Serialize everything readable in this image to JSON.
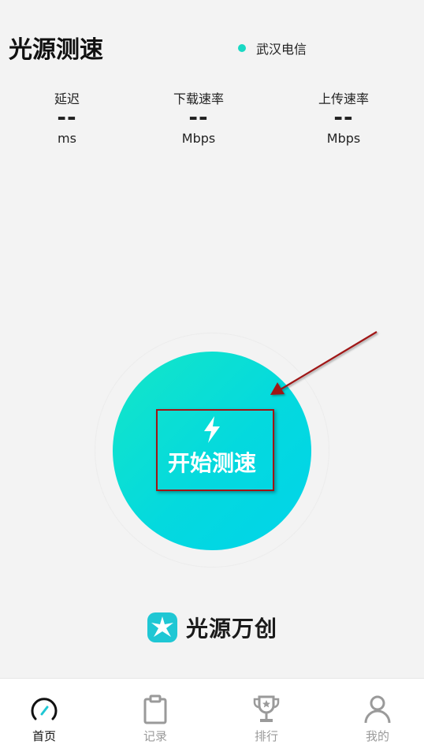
{
  "header": {
    "title": "光源测速",
    "network_name": "武汉电信",
    "network_dot_color": "#19d9c4"
  },
  "metrics": [
    {
      "label": "延迟",
      "value": "--",
      "unit": "ms"
    },
    {
      "label": "下载速率",
      "value": "--",
      "unit": "Mbps"
    },
    {
      "label": "上传速率",
      "value": "--",
      "unit": "Mbps"
    }
  ],
  "start": {
    "label": "开始测速",
    "icon": "lightning-bolt-icon",
    "gradient_from": "#14e6c7",
    "gradient_to": "#00d4ea",
    "highlight_color": "#a01515"
  },
  "brand": {
    "name": "光源万创",
    "logo_color": "#1fc7d4"
  },
  "tabs": [
    {
      "label": "首页",
      "icon": "speedometer-icon",
      "active": true
    },
    {
      "label": "记录",
      "icon": "clipboard-icon",
      "active": false
    },
    {
      "label": "排行",
      "icon": "trophy-icon",
      "active": false
    },
    {
      "label": "我的",
      "icon": "user-icon",
      "active": false
    }
  ]
}
